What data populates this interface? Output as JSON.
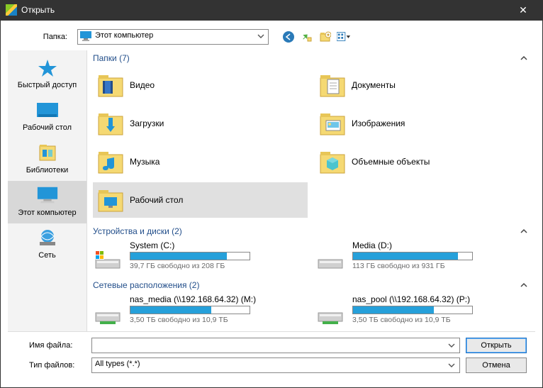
{
  "titlebar": {
    "title": "Открыть"
  },
  "topbar": {
    "label": "Папка:",
    "location": "Этот компьютер"
  },
  "sidebar": {
    "items": [
      {
        "label": "Быстрый доступ",
        "icon": "star"
      },
      {
        "label": "Рабочий стол",
        "icon": "desktop"
      },
      {
        "label": "Библиотеки",
        "icon": "libraries"
      },
      {
        "label": "Этот компьютер",
        "icon": "computer",
        "active": true
      },
      {
        "label": "Сеть",
        "icon": "network"
      }
    ]
  },
  "sections": {
    "folders_title": "Папки (7)",
    "devices_title": "Устройства и диски (2)",
    "network_title": "Сетевые расположения (2)"
  },
  "folders": [
    {
      "label": "Видео",
      "icon": "video"
    },
    {
      "label": "Документы",
      "icon": "documents"
    },
    {
      "label": "Загрузки",
      "icon": "downloads"
    },
    {
      "label": "Изображения",
      "icon": "images"
    },
    {
      "label": "Музыка",
      "icon": "music"
    },
    {
      "label": "Объемные объекты",
      "icon": "3d"
    },
    {
      "label": "Рабочий стол",
      "icon": "desktopfolder",
      "selected": true
    }
  ],
  "drives": [
    {
      "name": "System (C:)",
      "free": "39,7 ГБ свободно из 208 ГБ",
      "pct": 81
    },
    {
      "name": "Media (D:)",
      "free": "113 ГБ свободно из 931 ГБ",
      "pct": 88
    }
  ],
  "netlocs": [
    {
      "name": "nas_media (\\\\192.168.64.32) (M:)",
      "free": "3,50 ТБ свободно из 10,9 ТБ",
      "pct": 68
    },
    {
      "name": "nas_pool (\\\\192.168.64.32) (P:)",
      "free": "3,50 ТБ свободно из 10,9 ТБ",
      "pct": 68
    }
  ],
  "footer": {
    "filename_label": "Имя файла:",
    "filetype_label": "Тип файлов:",
    "filename_value": "",
    "filetype_value": "All types (*.*)",
    "open_label": "Открыть",
    "cancel_label": "Отмена"
  }
}
